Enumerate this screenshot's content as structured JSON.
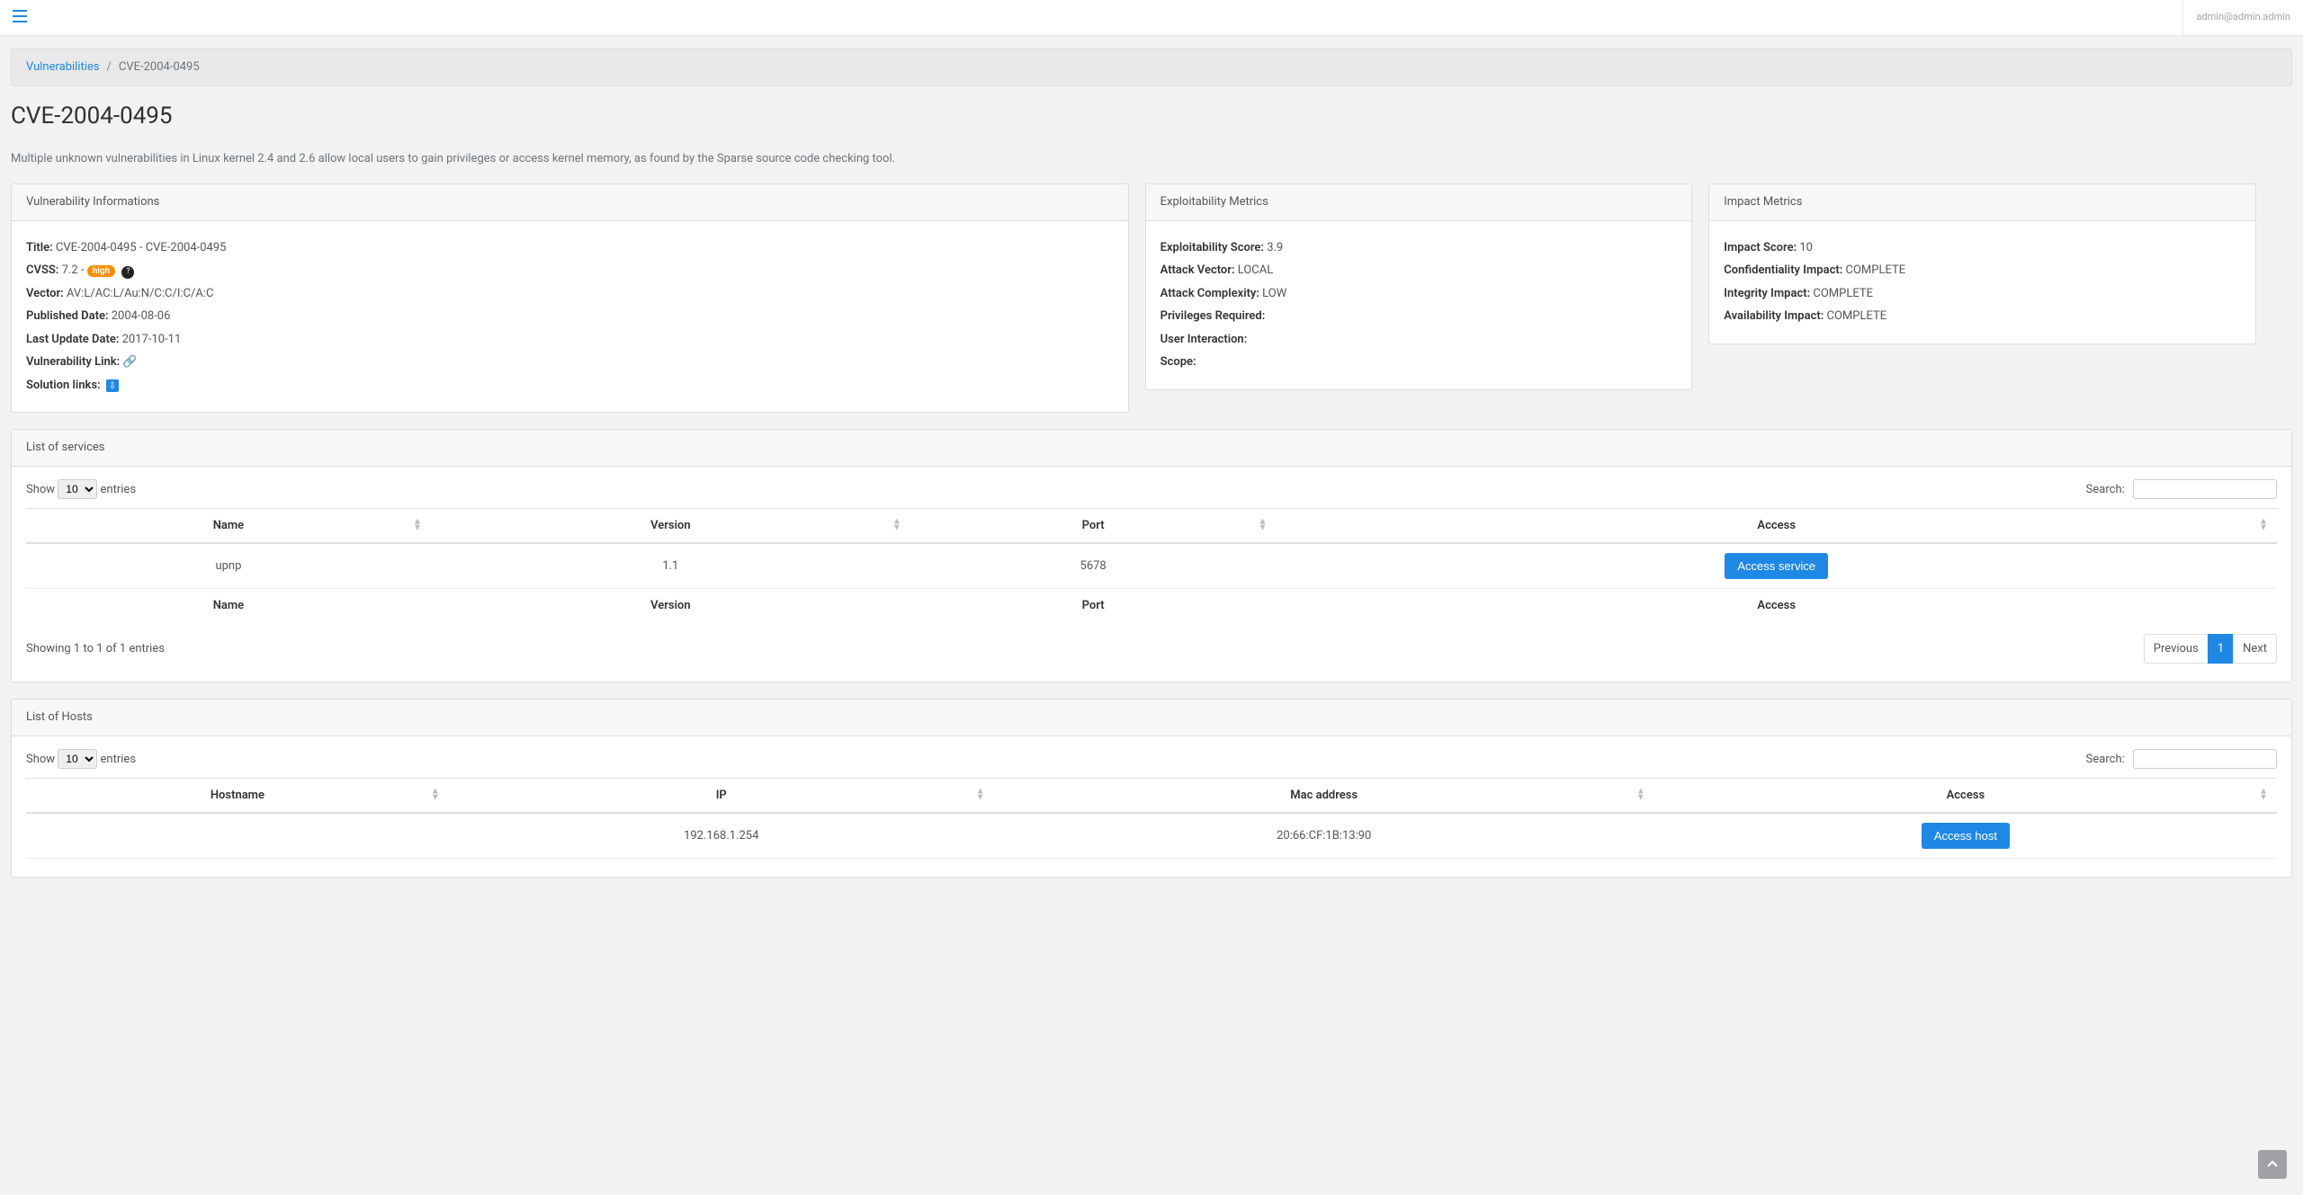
{
  "topbar": {
    "user": "admin@admin.admin"
  },
  "breadcrumb": {
    "root": "Vulnerabilities",
    "current": "CVE-2004-0495"
  },
  "page_title": "CVE-2004-0495",
  "description": "Multiple unknown vulnerabilities in Linux kernel 2.4 and 2.6 allow local users to gain privileges or access kernel memory, as found by the Sparse source code checking tool.",
  "vuln_info": {
    "header": "Vulnerability Informations",
    "title_label": "Title:",
    "title_value": "CVE-2004-0495 - CVE-2004-0495",
    "cvss_label": "CVSS:",
    "cvss_value": "7.2 - ",
    "cvss_badge": "high",
    "vector_label": "Vector:",
    "vector_value": "AV:L/AC:L/Au:N/C:C/I:C/A:C",
    "published_label": "Published Date:",
    "published_value": "2004-08-06",
    "updated_label": "Last Update Date:",
    "updated_value": "2017-10-11",
    "link_label": "Vulnerability Link:",
    "solution_label": "Solution links:"
  },
  "exploit": {
    "header": "Exploitability Metrics",
    "score_label": "Exploitability Score:",
    "score_value": "3.9",
    "vector_label": "Attack Vector:",
    "vector_value": "LOCAL",
    "complexity_label": "Attack Complexity:",
    "complexity_value": "LOW",
    "priv_label": "Privileges Required:",
    "priv_value": "",
    "ui_label": "User Interaction:",
    "ui_value": "",
    "scope_label": "Scope:",
    "scope_value": ""
  },
  "impact": {
    "header": "Impact Metrics",
    "score_label": "Impact Score:",
    "score_value": "10",
    "conf_label": "Confidentiality Impact:",
    "conf_value": "COMPLETE",
    "integ_label": "Integrity Impact:",
    "integ_value": "COMPLETE",
    "avail_label": "Availability Impact:",
    "avail_value": "COMPLETE"
  },
  "services": {
    "header": "List of services",
    "show_prefix": "Show",
    "show_suffix": "entries",
    "show_options": [
      "10"
    ],
    "show_selected": "10",
    "search_label": "Search:",
    "columns": [
      "Name",
      "Version",
      "Port",
      "Access"
    ],
    "rows": [
      {
        "name": "upnp",
        "version": "1.1",
        "port": "5678",
        "access_btn": "Access service"
      }
    ],
    "info": "Showing 1 to 1 of 1 entries",
    "prev": "Previous",
    "next": "Next",
    "page": "1"
  },
  "hosts": {
    "header": "List of Hosts",
    "show_prefix": "Show",
    "show_suffix": "entries",
    "show_options": [
      "10"
    ],
    "show_selected": "10",
    "search_label": "Search:",
    "columns": [
      "Hostname",
      "IP",
      "Mac address",
      "Access"
    ],
    "rows": [
      {
        "hostname": "",
        "ip": "192.168.1.254",
        "mac": "20:66:CF:1B:13:90",
        "access_btn": "Access host"
      }
    ]
  }
}
